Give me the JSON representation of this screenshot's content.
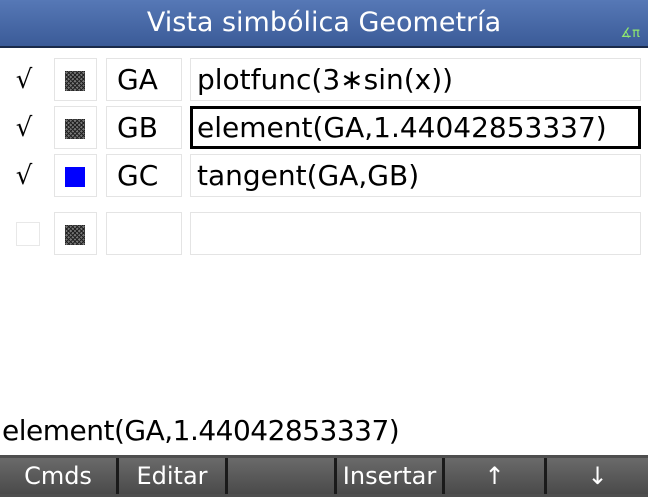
{
  "app": {
    "title": "Vista simbólica Geometría",
    "angle_indicator": "∡π"
  },
  "rows": [
    {
      "checked": true,
      "check_glyph": "√",
      "color": "pattern",
      "name": "GA",
      "expression": "plotfunc(3∗sin(x))",
      "selected": false
    },
    {
      "checked": true,
      "check_glyph": "√",
      "color": "pattern",
      "name": "GB",
      "expression": "element(GA,1.44042853337)",
      "selected": true
    },
    {
      "checked": true,
      "check_glyph": "√",
      "color": "#0000ff",
      "name": "GC",
      "expression": "tangent(GA,GB)",
      "selected": false
    },
    {
      "checked": false,
      "check_glyph": "",
      "color": "pattern",
      "name": "",
      "expression": "",
      "selected": false
    }
  ],
  "edit_line": "element(GA,1.44042853337)",
  "softkeys": {
    "cmds": "Cmds",
    "editar": "Editar",
    "blank": "",
    "insertar": "Insertar",
    "up": "↑",
    "down": "↓"
  },
  "colors": {
    "title_bar": "#3b5b98",
    "angle_indicator": "#8fe86e",
    "selected_swatch_blue": "#0000ff",
    "menu_bar": "#4e4e4e"
  }
}
